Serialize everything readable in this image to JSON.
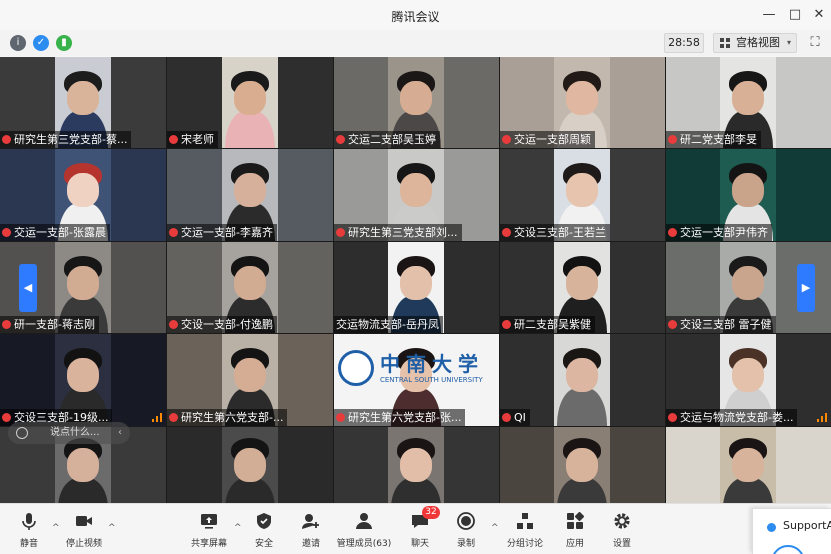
{
  "window": {
    "title": "腾讯会议",
    "minimize": "—",
    "maximize": "□",
    "close": "✕"
  },
  "infobar": {
    "icons": [
      {
        "name": "info-icon",
        "glyph": "i",
        "color": "#5f6670"
      },
      {
        "name": "shield-icon",
        "glyph": "✓",
        "color": "#2d8cf0"
      },
      {
        "name": "signal-icon",
        "glyph": "▮",
        "color": "#38b24a"
      }
    ],
    "timer": "28:58",
    "view_label": "宫格视图",
    "view_chevron": "▾",
    "fullscreen_glyph": "⛶"
  },
  "participants": [
    {
      "name": "研究生第三党支部-蔡...",
      "bg": "#3b3b3b",
      "cam": "#c9ccd3",
      "skin": "#d9b49a",
      "hair": "#1c1c1c",
      "shirt": "#2b3b5f"
    },
    {
      "name": "宋老师",
      "bg": "#2e2e2e",
      "cam": "#d7d3c9",
      "skin": "#d9ae90",
      "hair": "#1a1a1a",
      "shirt": "#e9b3b6"
    },
    {
      "name": "交运二支部吴玉婷",
      "bg": "#6c6a66",
      "cam": "#9b948a",
      "skin": "#d6ad92",
      "hair": "#1a1716",
      "shirt": "#4c4848"
    },
    {
      "name": "交运一支部周颖",
      "bg": "#a99f96",
      "cam": "#c3b8ad",
      "skin": "#e0b7a0",
      "hair": "#221a16",
      "shirt": "#d8cfc7"
    },
    {
      "name": "研二党支部李旻",
      "bg": "#c7c7c5",
      "cam": "#e4e4e2",
      "skin": "#d8b096",
      "hair": "#161616",
      "shirt": "#2a2a2a"
    },
    {
      "name": "交运一支部-张露晨",
      "bg": "#2b3750",
      "cam": "#3f5377",
      "skin": "#efd2c2",
      "hair": "#b5352e",
      "shirt": "#f0f0f0"
    },
    {
      "name": "交运一支部-李嘉齐",
      "bg": "#565b62",
      "cam": "#b7b9bc",
      "skin": "#d6b09a",
      "hair": "#1a1a1a",
      "shirt": "#2b2b2b"
    },
    {
      "name": "研究生第三党支部刘...",
      "bg": "#9a9a98",
      "cam": "#c9c9c7",
      "skin": "#dcb59b",
      "hair": "#161616",
      "shirt": "#cbcbc9"
    },
    {
      "name": "交设三支部-王若兰",
      "bg": "#3a3a3a",
      "cam": "#d9dde4",
      "skin": "#e6c4ae",
      "hair": "#1d1a19",
      "shirt": "#f1f1f1"
    },
    {
      "name": "交运一支部尹伟齐",
      "bg": "#113b36",
      "cam": "#1e5c52",
      "skin": "#c9a48b",
      "hair": "#141414",
      "shirt": "#e4e4e4"
    },
    {
      "name": "研一支部-蒋志刚",
      "bg": "#53514f",
      "cam": "#8d8a86",
      "skin": "#d2ab93",
      "hair": "#161616",
      "shirt": "#3a3a3a"
    },
    {
      "name": "交设一支部-付逸鹏",
      "bg": "#64625f",
      "cam": "#a6a39f",
      "skin": "#d1ab92",
      "hair": "#141414",
      "shirt": "#2c2c2c"
    },
    {
      "name": "交运物流支部-岳丹凤",
      "bg": "#2d2d2d",
      "cam": "#f2f2f2",
      "skin": "#e3c0a9",
      "hair": "#1a1514",
      "shirt": "#1f3a5a"
    },
    {
      "name": "研二支部吴紫健",
      "bg": "#303030",
      "cam": "#e2e2e0",
      "skin": "#d8b39b",
      "hair": "#121212",
      "shirt": "#1f1f1f"
    },
    {
      "name": "交设三支部 雷子健",
      "bg": "#6b6d6b",
      "cam": "#a9aba9",
      "skin": "#c9a58d",
      "hair": "#1a1a1a",
      "shirt": "#3a3a3a"
    },
    {
      "name": "交设三支部-19级...",
      "bg": "#171a24",
      "cam": "#2b2f3f",
      "skin": "#d9b39c",
      "hair": "#121212",
      "shirt": "#2a2a2a"
    },
    {
      "name": "研究生第六党支部-...",
      "bg": "#6b6359",
      "cam": "#b9b1a6",
      "skin": "#d5ad94",
      "hair": "#141414",
      "shirt": "#2b2b2b"
    },
    {
      "name": "研究生第六党支部-张...",
      "bg": "#f4f4f4",
      "cam": "#f4f4f4",
      "skin": "#e6c2ab",
      "hair": "#1a1514",
      "shirt": "#4d2d2d"
    },
    {
      "name": "QI",
      "bg": "#2f2f2f",
      "cam": "#d8d8d6",
      "skin": "#dcb6a0",
      "hair": "#1a1614",
      "shirt": "#6b6b6b"
    },
    {
      "name": "交运与物流党支部-娄...",
      "bg": "#2e2e2e",
      "cam": "#e6e6e6",
      "skin": "#e3c1aa",
      "hair": "#4a3226",
      "shirt": "#cfcfcf"
    },
    {
      "name": "",
      "bg": "#3a3a3a",
      "cam": "#6b6b6b",
      "skin": "#d5b09a",
      "hair": "#141414",
      "shirt": "#2a2a2a"
    },
    {
      "name": "",
      "bg": "#2a2a2a",
      "cam": "#4b4b4b",
      "skin": "#d3ae96",
      "hair": "#141414",
      "shirt": "#2a2a2a"
    },
    {
      "name": "",
      "bg": "#353535",
      "cam": "#7a7570",
      "skin": "#e2bea8",
      "hair": "#1a1514",
      "shirt": "#2f2f2f"
    },
    {
      "name": "",
      "bg": "#4b4540",
      "cam": "#8a7f74",
      "skin": "#d8b39c",
      "hair": "#1a1514",
      "shirt": "#3a3a3a"
    },
    {
      "name": "",
      "bg": "#d9d4cc",
      "cam": "#c8bda8",
      "skin": "#d8b39c",
      "hair": "#1a1514",
      "shirt": "#3a3a3a"
    }
  ],
  "grid": {
    "left_arrow": "◀",
    "right_arrow": "▶",
    "chat_placeholder": "说点什么...",
    "chat_arrow": "‹",
    "logo_text": "中南大学",
    "logo_sub": "CENTRAL SOUTH UNIVERSITY"
  },
  "toolbar": {
    "items": [
      {
        "key": "mute",
        "label": "静音",
        "icon": "microphone-icon"
      },
      {
        "key": "video",
        "label": "停止视频",
        "icon": "video-camera-icon"
      },
      {
        "key": "share",
        "label": "共享屏幕",
        "icon": "share-screen-icon"
      },
      {
        "key": "security",
        "label": "安全",
        "icon": "shield-icon"
      },
      {
        "key": "invite",
        "label": "邀请",
        "icon": "invite-icon"
      },
      {
        "key": "members",
        "label": "管理成员(63)",
        "icon": "members-icon"
      },
      {
        "key": "chat",
        "label": "聊天",
        "icon": "chat-icon"
      },
      {
        "key": "record",
        "label": "录制",
        "icon": "record-icon"
      },
      {
        "key": "breakout",
        "label": "分组讨论",
        "icon": "breakout-icon"
      },
      {
        "key": "apps",
        "label": "应用",
        "icon": "apps-icon"
      },
      {
        "key": "settings",
        "label": "设置",
        "icon": "gear-icon"
      }
    ],
    "chat_badge": "32",
    "chevron": "^"
  },
  "support": {
    "label": "SupportA"
  }
}
